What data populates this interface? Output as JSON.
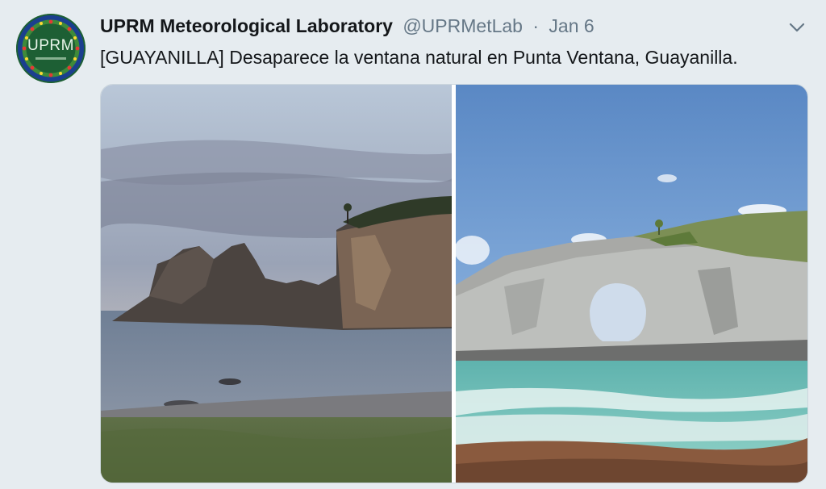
{
  "tweet": {
    "author_name": "UPRM Meteorological Laboratory",
    "author_handle": "@UPRMetLab",
    "separator": "·",
    "date": "Jan 6",
    "text": "[GUAYANILLA] Desaparece la ventana natural en Punta Ventana, Guayanilla.",
    "avatar_label": "UPRM",
    "menu_icon": "chevron-down-icon",
    "colors": {
      "name": "#14171a",
      "secondary_text": "#657786",
      "background": "#e6ecf0",
      "avatar_green": "#1f6b3a"
    }
  }
}
